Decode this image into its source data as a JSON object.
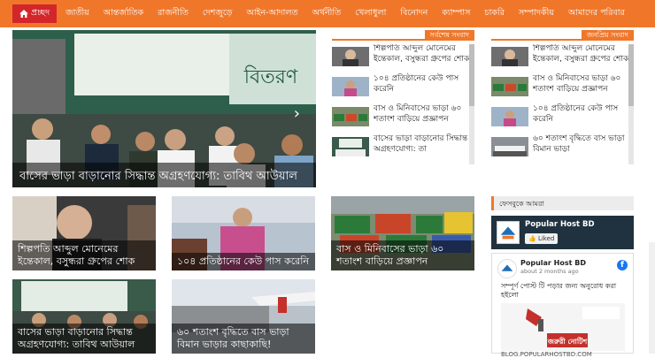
{
  "nav": {
    "home": "প্রচ্ছদ",
    "items": [
      "জাতীয়",
      "আন্তর্জাতিক",
      "রাজনীতি",
      "দেশজুড়ে",
      "আইন-আদালত",
      "অর্থনীতি",
      "খেলাধুলা",
      "বিনোদন",
      "ক্যাম্পাস",
      "চাকরি",
      "সম্পাদকীয়",
      "আমাদের পরিবার"
    ]
  },
  "hero": {
    "caption": "বাসের ভাড়া বাড়ানোর সিদ্ধান্ত অগ্রহণযোগ্য: তাবিথ আউয়াল",
    "banner_text": "বিতরণ"
  },
  "latest": {
    "title": "সর্বশেষ সংবাদ",
    "items": [
      "শিল্পপতি আব্দুল মোনেমের ইন্তেকাল, বসুন্ধরা গ্রুপের শোক",
      "১০৪ প্রতিষ্ঠানের কেউ পাস করেনি",
      "বাস ও মিনিবাসের ভাড়া ৬০ শতাংশ বাড়িয়ে প্রজ্ঞাপন",
      "বাসের ভাড়া বাড়ানোর সিদ্ধান্ত অগ্রহণযোগ্য: তা"
    ]
  },
  "popular": {
    "title": "জনপ্রিয় সংবাদ",
    "items": [
      "শিল্পপতি আব্দুল মোনেমের ইন্তেকাল, বসুন্ধরা গ্রুপের শোক",
      "বাস ও মিনিবাসের ভাড়া ৬০ শতাংশ বাড়িয়ে প্রজ্ঞাপন",
      "১০৪ প্রতিষ্ঠানের কেউ পাস করেনি",
      "৬০ শতাংশ বৃদ্ধিতে বাস ভাড়া বিমান ভাড়া"
    ]
  },
  "cards": [
    "শিল্পপতি আব্দুল মোনেমের ইন্তেকাল, বসুন্ধরা গ্রুপের শোক",
    "১০৪ প্রতিষ্ঠানের কেউ পাস করেনি",
    "বাস ও মিনিবাসের ভাড়া ৬০ শতাংশ বাড়িয়ে প্রজ্ঞাপন",
    "বাসের ভাড়া বাড়ানোর সিদ্ধান্ত অগ্রহণযোগ্য: তাবিথ আউয়াল",
    "৬০ শতাংশ বৃদ্ধিতে বাস ভাড়া বিমান ভাড়ার কাছাকাছি!"
  ],
  "facebook": {
    "title": "ফেসবুকে আমরা",
    "page_name": "Popular Host BD",
    "liked": "Liked",
    "post_time": "about 2 months ago",
    "post_text": "সম্পূর্ণ পোস্ট টি পড়ার জন্য অনুরোধ করা হইলো",
    "notice": "জরুরী নোটিশ",
    "url": "BLOG.POPULARHOSTBD.COM"
  },
  "colors": {
    "accent": "#f0772a",
    "home": "#d3262a"
  }
}
